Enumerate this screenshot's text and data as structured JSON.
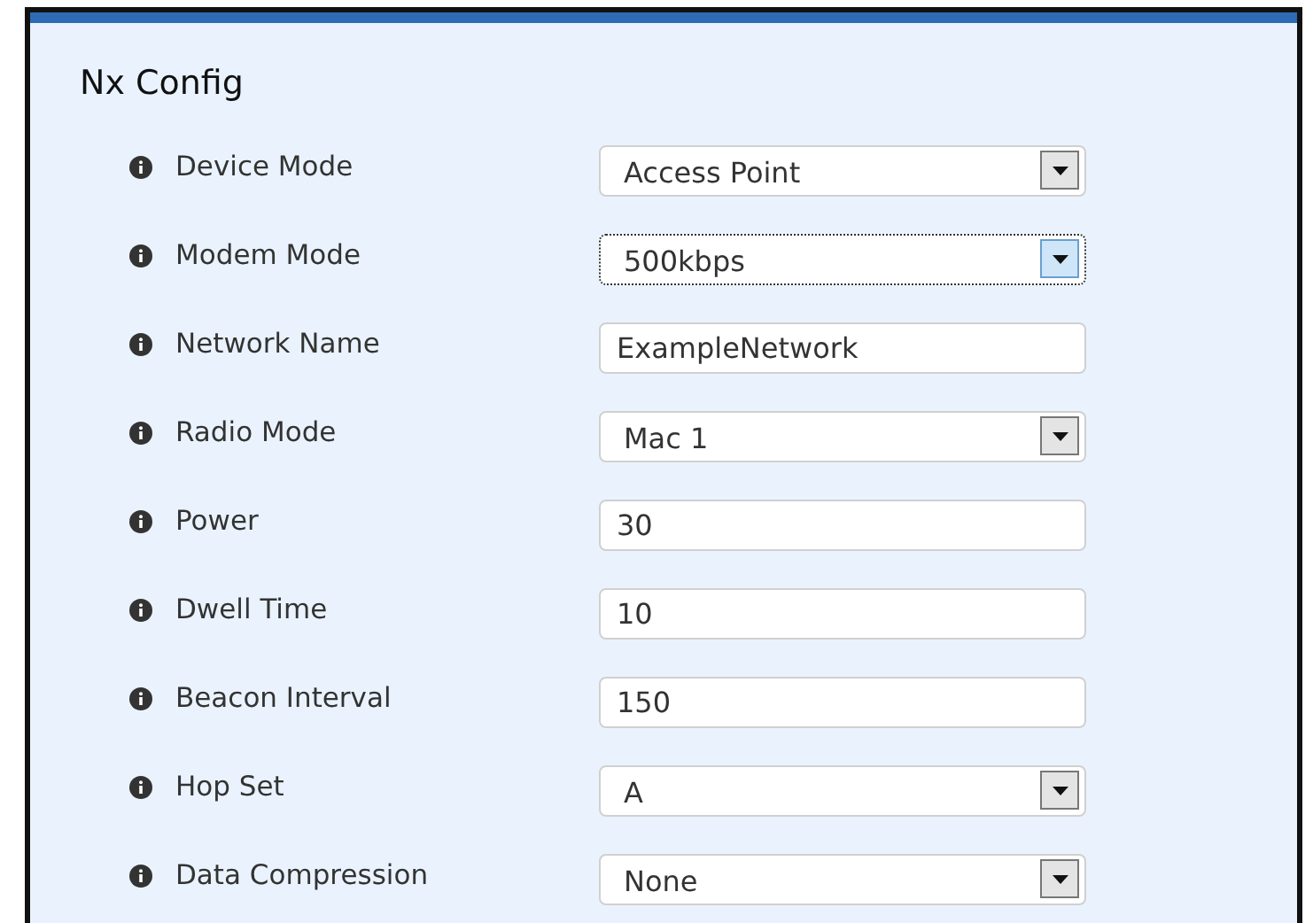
{
  "panel": {
    "title": "Nx Config"
  },
  "fields": [
    {
      "label": "Device Mode",
      "kind": "select",
      "value": "Access Point",
      "focused": false
    },
    {
      "label": "Modem Mode",
      "kind": "select",
      "value": "500kbps",
      "focused": true
    },
    {
      "label": "Network Name",
      "kind": "text",
      "value": "ExampleNetwork",
      "focused": false
    },
    {
      "label": "Radio Mode",
      "kind": "select",
      "value": "Mac 1",
      "focused": false
    },
    {
      "label": "Power",
      "kind": "text",
      "value": "30",
      "focused": false
    },
    {
      "label": "Dwell Time",
      "kind": "text",
      "value": "10",
      "focused": false
    },
    {
      "label": "Beacon Interval",
      "kind": "text",
      "value": "150",
      "focused": false
    },
    {
      "label": "Hop Set",
      "kind": "select",
      "value": "A",
      "focused": false
    },
    {
      "label": "Data Compression",
      "kind": "select",
      "value": "None",
      "focused": false
    }
  ]
}
